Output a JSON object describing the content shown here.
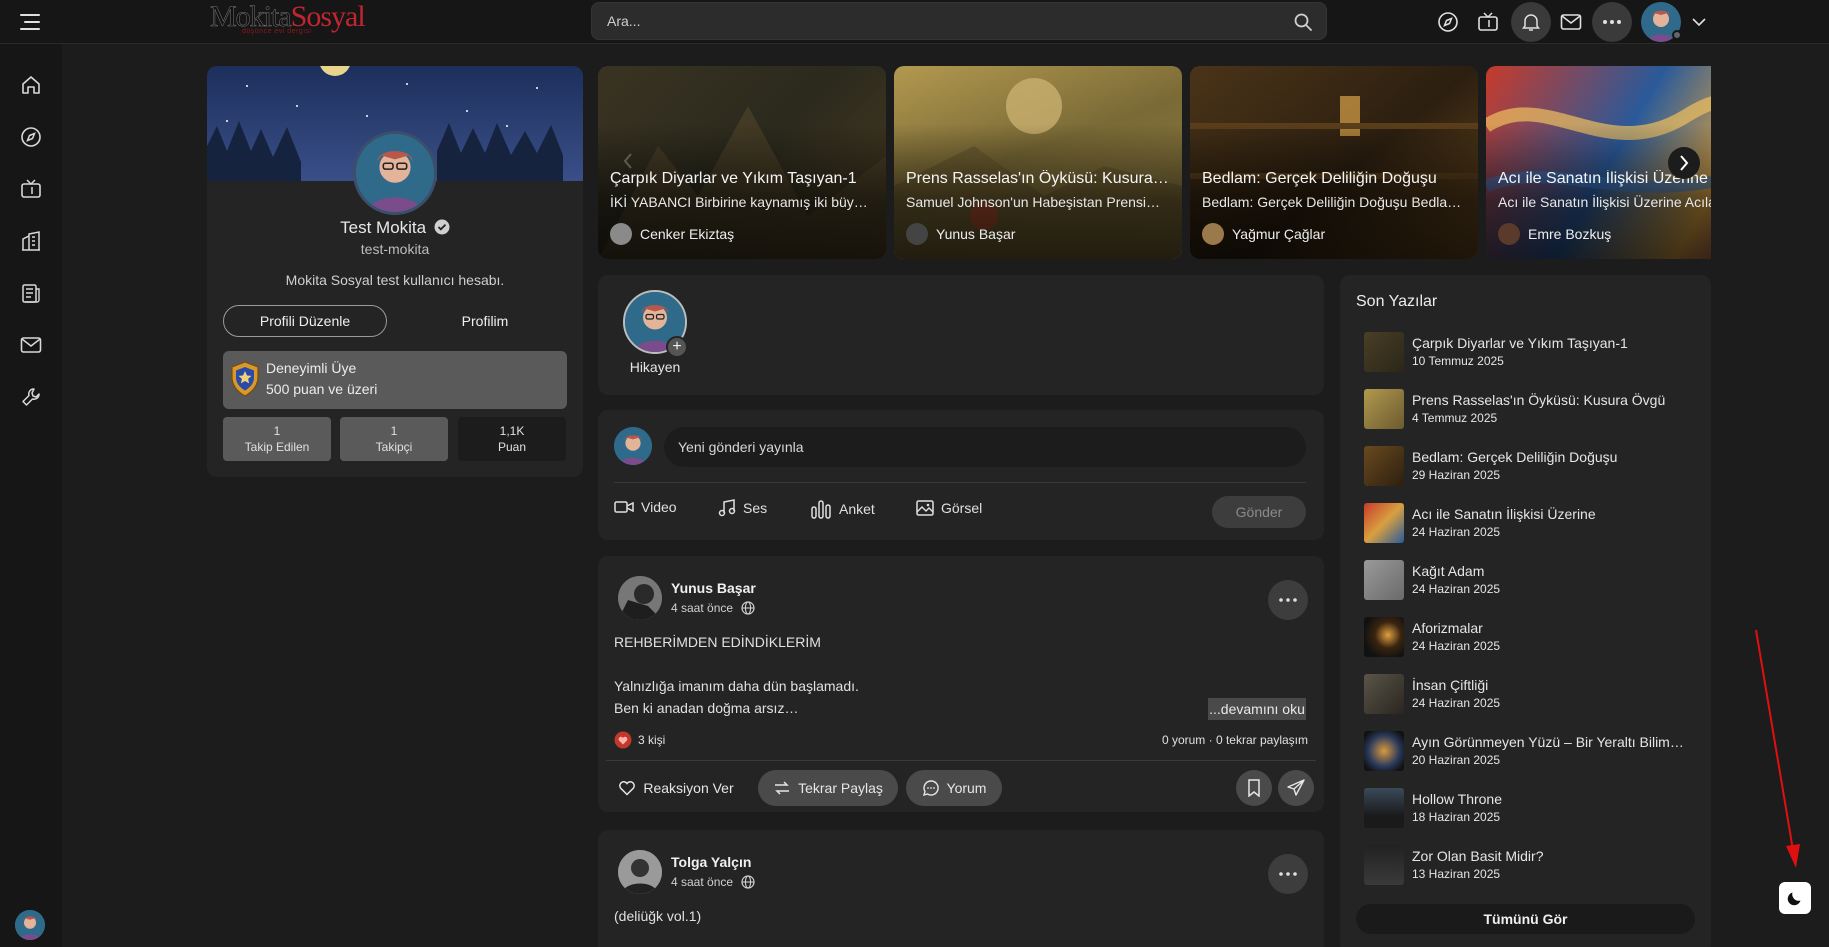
{
  "header": {
    "logo_part1": "Mokita",
    "logo_part2": "Sosyal",
    "logo_tagline": "düşünce evi dergisi",
    "search_placeholder": "Ara..."
  },
  "profile": {
    "name": "Test Mokita",
    "username": "test-mokita",
    "bio": "Mokita Sosyal test kullanıcı hesabı.",
    "edit_label": "Profili Düzenle",
    "my_profile_label": "Profilim",
    "level_title": "Deneyimli Üye",
    "level_desc": "500 puan ve üzeri",
    "stats": [
      {
        "value": "1",
        "label": "Takip Edilen"
      },
      {
        "value": "1",
        "label": "Takipçi"
      },
      {
        "value": "1,1K",
        "label": "Puan"
      }
    ]
  },
  "stories": [
    {
      "title": "Çarpık Diyarlar ve Yıkım Taşıyan-1",
      "subtitle": "İKİ YABANCI Birbirine kaynamış iki büyük…",
      "author": "Cenker Ekiztaş"
    },
    {
      "title": "Prens Rasselas'ın Öyküsü: Kusura Övgü",
      "subtitle": "Samuel Johnson'un Habeşistan Prensi…",
      "author": "Yunus Başar"
    },
    {
      "title": "Bedlam: Gerçek Deliliğin Doğuşu",
      "subtitle": "Bedlam: Gerçek Deliliğin Doğuşu Bedlam…",
      "author": "Yağmur Çağlar"
    },
    {
      "title": "Acı ile Sanatın İlişkisi Üzerine",
      "subtitle": "Acı ile Sanatın İlişkisi Üzerine Acıla…",
      "author": "Emre Bozkuş"
    }
  ],
  "story_bubble": {
    "label": "Hikayen"
  },
  "composer": {
    "placeholder": "Yeni gönderi yayınla",
    "actions": [
      "Video",
      "Ses",
      "Anket",
      "Görsel"
    ],
    "send_label": "Gönder"
  },
  "post": {
    "author": "Yunus Başar",
    "time": "4 saat önce",
    "heading": "REHBERİMDEN EDİNDİKLERİM",
    "line1": "Yalnızlığa imanım daha dün başlamadı.",
    "line2": "Ben ki anadan doğma arsız…",
    "read_more": "...devamını oku",
    "reactions": "3 kişi",
    "counts": "0 yorum · 0 tekrar paylaşım",
    "react_label": "Reaksiyon Ver",
    "share_label": "Tekrar Paylaş",
    "comment_label": "Yorum"
  },
  "post2": {
    "author": "Tolga Yalçın",
    "time": "4 saat önce",
    "text": "(deliüğk vol.1)"
  },
  "recent": {
    "title": "Son Yazılar",
    "see_all": "Tümünü Gör",
    "items": [
      {
        "title": "Çarpık Diyarlar ve Yıkım Taşıyan-1",
        "date": "10 Temmuz 2025"
      },
      {
        "title": "Prens Rasselas'ın Öyküsü: Kusura Övgü",
        "date": "4 Temmuz 2025"
      },
      {
        "title": "Bedlam: Gerçek Deliliğin Doğuşu",
        "date": "29 Haziran 2025"
      },
      {
        "title": "Acı ile Sanatın İlişkisi Üzerine",
        "date": "24 Haziran 2025"
      },
      {
        "title": "Kağıt Adam",
        "date": "24 Haziran 2025"
      },
      {
        "title": "Aforizmalar",
        "date": "24 Haziran 2025"
      },
      {
        "title": "İnsan Çiftliği",
        "date": "24 Haziran 2025"
      },
      {
        "title": "Ayın Görünmeyen Yüzü – Bir Yeraltı Bilim…",
        "date": "20 Haziran 2025"
      },
      {
        "title": "Hollow Throne",
        "date": "18 Haziran 2025"
      },
      {
        "title": "Zor Olan Basit Midir?",
        "date": "13 Haziran 2025"
      }
    ]
  },
  "colors": {
    "accent_red": "#c0262f",
    "background": "#1c1c1c",
    "card": "#242424"
  }
}
